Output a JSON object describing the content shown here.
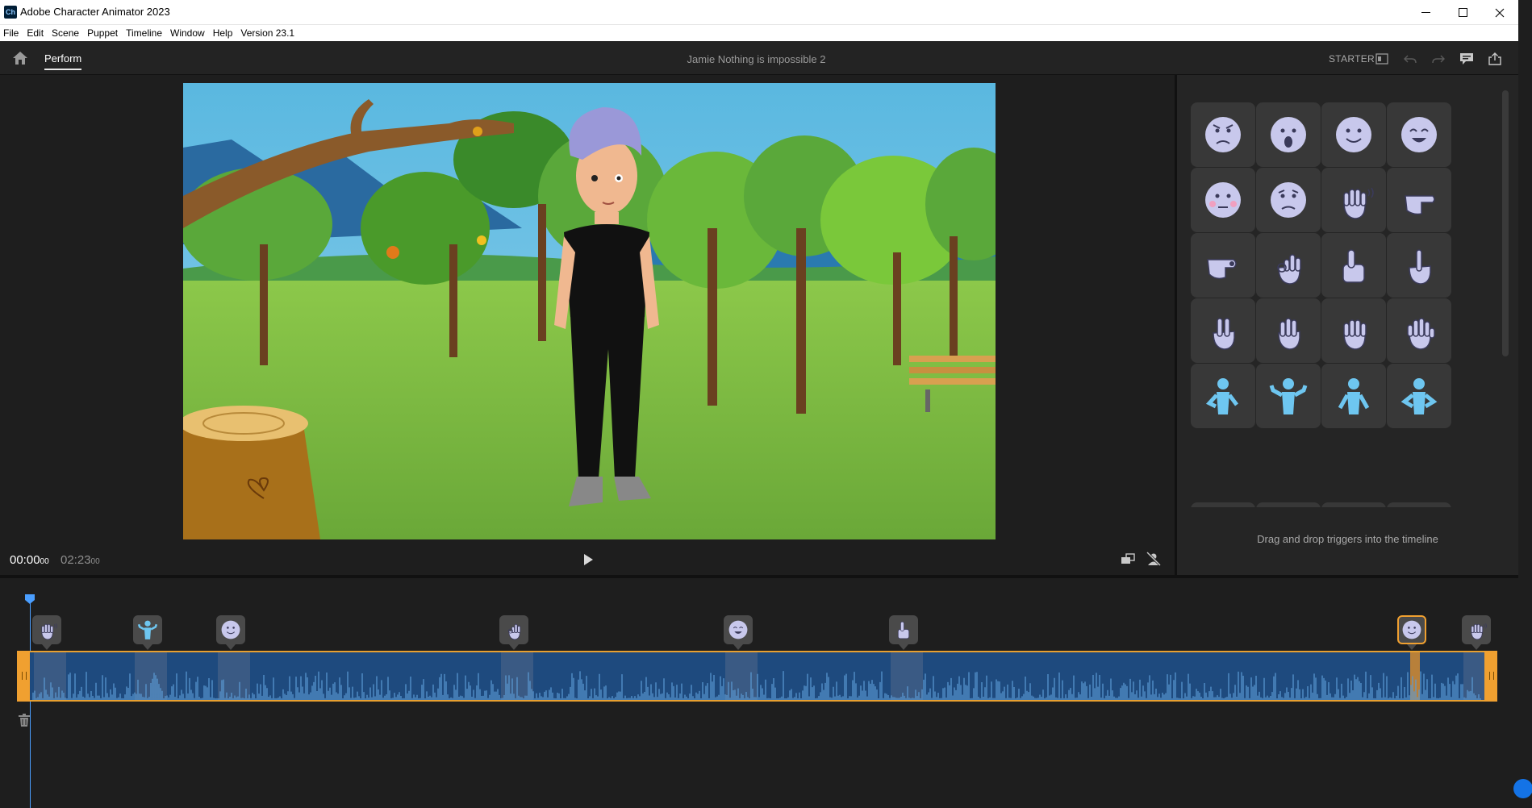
{
  "window": {
    "app_icon_text": "Ch",
    "title": "Adobe Character Animator 2023"
  },
  "menu": [
    "File",
    "Edit",
    "Scene",
    "Puppet",
    "Timeline",
    "Window",
    "Help",
    "Version 23.1"
  ],
  "header": {
    "mode_tab": "Perform",
    "project_title": "Jamie Nothing is impossible 2",
    "plan": "STARTER",
    "icons": [
      "home-icon",
      "layout-icon",
      "undo-icon",
      "redo-icon",
      "feedback-icon",
      "share-icon"
    ]
  },
  "transport": {
    "current_time": "00:00",
    "current_frames": "00",
    "total_time": "02:23",
    "total_frames": "00"
  },
  "triggers_panel": {
    "hint": "Drag and drop triggers into the timeline",
    "triggers": [
      "angry",
      "surprised",
      "happy",
      "joyful",
      "blush",
      "worried",
      "wave",
      "point-right",
      "point-forward",
      "ok-hand",
      "thumbs-up",
      "point-up",
      "peace",
      "three-fingers",
      "four-fingers",
      "open-hand",
      "pose-hand-on-hip",
      "pose-shrug",
      "pose-arms-down",
      "pose-hands-on-hips"
    ]
  },
  "timeline": {
    "markers": [
      "wave",
      "pose-shrug",
      "happy",
      "ok-hand",
      "joyful",
      "thumbs-up",
      "happy",
      "wave"
    ],
    "selected_marker": 6
  },
  "colors": {
    "accent_orange": "#f0a030",
    "track_blue": "#1e4a7e",
    "waveform_blue": "#5b9bd5",
    "trigger_face": "#c8c8ec",
    "trigger_body": "#6ec6f0",
    "playhead": "#4a9eff"
  }
}
